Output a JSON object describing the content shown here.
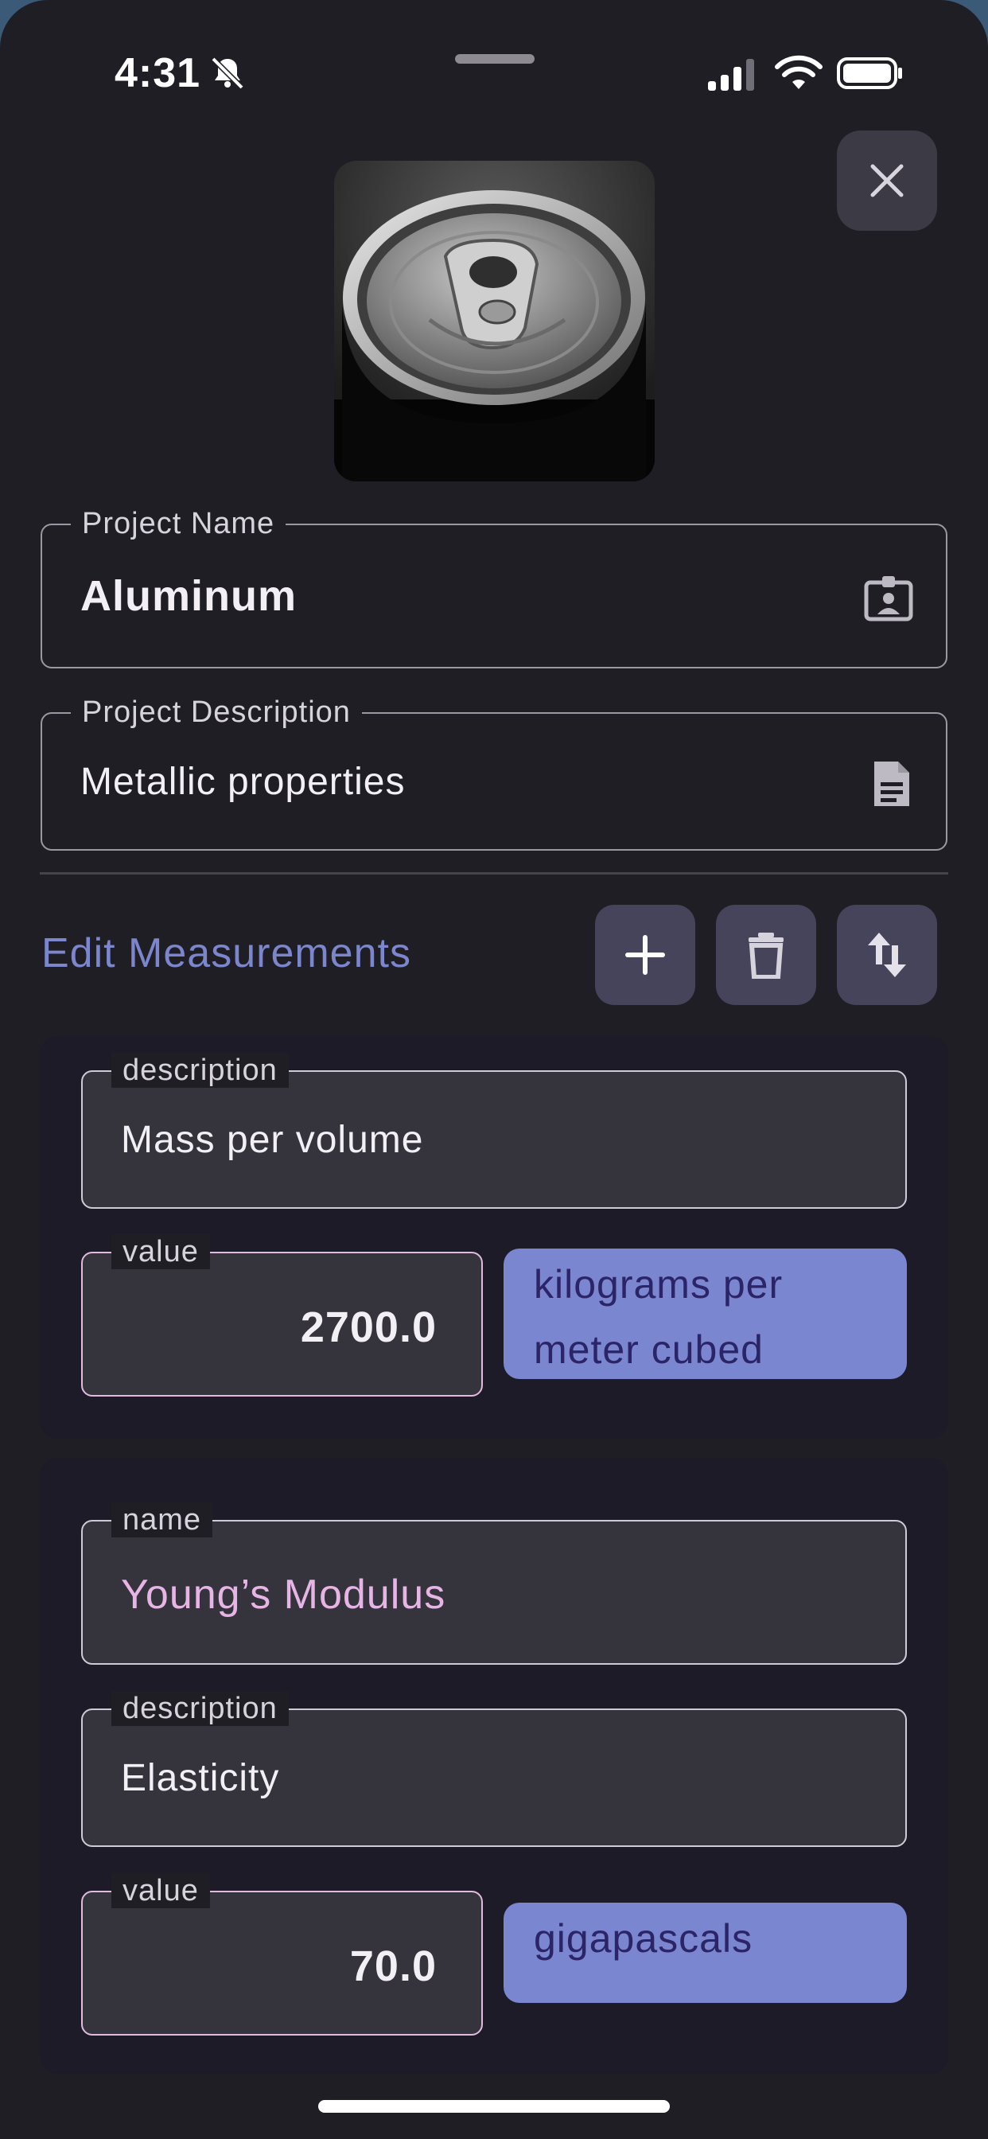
{
  "status_bar": {
    "time": "4:31"
  },
  "project": {
    "name_label": "Project Name",
    "name_value": "Aluminum",
    "description_label": "Project Description",
    "description_value": "Metallic properties"
  },
  "measurements": {
    "title": "Edit Measurements",
    "items": [
      {
        "description_label": "description",
        "description_value": "Mass per volume",
        "value_label": "value",
        "value": "2700.0",
        "unit": "kilograms per meter cubed"
      },
      {
        "name_label": "name",
        "name_value": "Young’s Modulus",
        "description_label": "description",
        "description_value": "Elasticity",
        "value_label": "value",
        "value": "70.0",
        "unit": "gigapascals"
      }
    ]
  },
  "colors": {
    "background": "#1f1e25",
    "accent_title": "#7b86cc",
    "unit_chip": "#7a86cf",
    "name_text": "#e6b5e6"
  },
  "icons": [
    "bell-slash-icon",
    "signal-icon",
    "wifi-icon",
    "battery-icon",
    "close-icon",
    "id-card-icon",
    "document-icon",
    "plus-icon",
    "trash-icon",
    "sort-icon"
  ]
}
